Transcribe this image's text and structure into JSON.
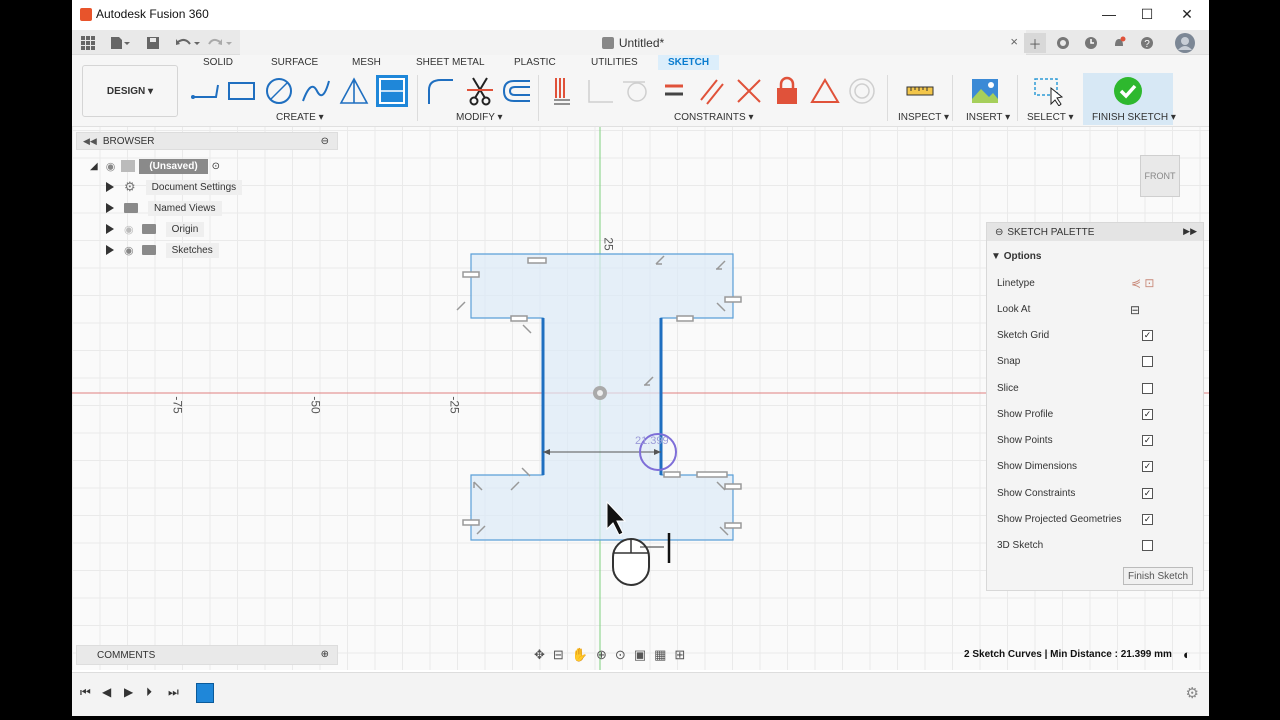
{
  "window": {
    "title": "Autodesk Fusion 360",
    "minimize": "—",
    "maximize": "☐",
    "close": "✕"
  },
  "document": {
    "tab_title": "Untitled*",
    "close": "×"
  },
  "tabs": [
    "SOLID",
    "SURFACE",
    "MESH",
    "SHEET METAL",
    "PLASTIC",
    "UTILITIES",
    "SKETCH"
  ],
  "active_tab": "SKETCH",
  "workspace": {
    "label": "DESIGN ▾"
  },
  "groups": {
    "create": "CREATE ▾",
    "modify": "MODIFY ▾",
    "constraints": "CONSTRAINTS ▾",
    "inspect": "INSPECT ▾",
    "insert": "INSERT ▾",
    "select": "SELECT ▾",
    "finish": "FINISH SKETCH ▾"
  },
  "browser": {
    "title": "BROWSER",
    "root": "(Unsaved)",
    "items": [
      "Document Settings",
      "Named Views",
      "Origin",
      "Sketches"
    ]
  },
  "viewcube": {
    "face": "FRONT"
  },
  "axis_labels": {
    "x_m75": "-75",
    "x_m50": "-50",
    "x_m25": "-25",
    "y_25": "25"
  },
  "dimension": {
    "value": "21.399"
  },
  "palette": {
    "title": "SKETCH PALETTE",
    "section": "Options",
    "rows": [
      {
        "label": "Linetype",
        "kind": "icons"
      },
      {
        "label": "Look At",
        "kind": "icon"
      },
      {
        "label": "Sketch Grid",
        "checked": true
      },
      {
        "label": "Snap",
        "checked": false
      },
      {
        "label": "Slice",
        "checked": false
      },
      {
        "label": "Show Profile",
        "checked": true
      },
      {
        "label": "Show Points",
        "checked": true
      },
      {
        "label": "Show Dimensions",
        "checked": true
      },
      {
        "label": "Show Constraints",
        "checked": true
      },
      {
        "label": "Show Projected Geometries",
        "checked": true
      },
      {
        "label": "3D Sketch",
        "checked": false
      }
    ],
    "finish_button": "Finish Sketch"
  },
  "comments": {
    "title": "COMMENTS"
  },
  "status": {
    "text": "2 Sketch Curves | Min Distance : 21.399 mm"
  },
  "colors": {
    "accent": "#0a7ccf",
    "finish_green": "#2eb82e",
    "sketch_line": "#1f6fc0",
    "profile_fill": "#dbeaf7",
    "x_axis": "#e07070",
    "y_axis": "#6fcf6f"
  }
}
